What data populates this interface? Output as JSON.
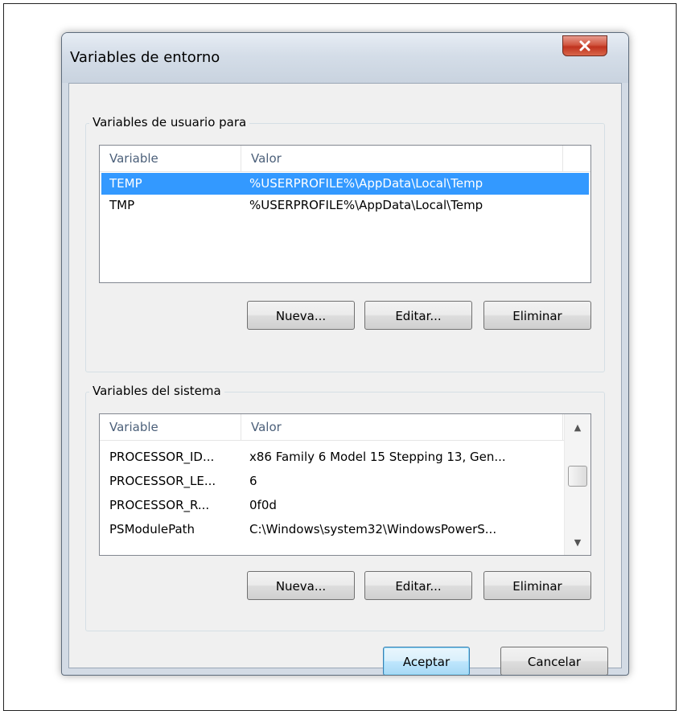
{
  "window": {
    "title": "Variables de entorno",
    "close_label": "X"
  },
  "user_vars": {
    "group_label": "Variables de usuario para",
    "columns": [
      "Variable",
      "Valor"
    ],
    "rows": [
      {
        "name": "TEMP",
        "value": "%USERPROFILE%\\AppData\\Local\\Temp",
        "selected": true
      },
      {
        "name": "TMP",
        "value": "%USERPROFILE%\\AppData\\Local\\Temp",
        "selected": false
      }
    ],
    "buttons": {
      "new": "Nueva...",
      "edit": "Editar...",
      "delete": "Eliminar"
    }
  },
  "system_vars": {
    "group_label": "Variables del sistema",
    "columns": [
      "Variable",
      "Valor"
    ],
    "rows": [
      {
        "name": "PROCESSOR_ID...",
        "value": "x86 Family 6 Model 15 Stepping 13, Gen..."
      },
      {
        "name": "PROCESSOR_LE...",
        "value": "6"
      },
      {
        "name": "PROCESSOR_R...",
        "value": "0f0d"
      },
      {
        "name": "PSModulePath",
        "value": "C:\\Windows\\system32\\WindowsPowerS..."
      }
    ],
    "buttons": {
      "new": "Nueva...",
      "edit": "Editar...",
      "delete": "Eliminar"
    }
  },
  "dialog_buttons": {
    "ok": "Aceptar",
    "cancel": "Cancelar"
  },
  "colors": {
    "selection": "#3399ff",
    "header_text": "#4c607a",
    "close_button": "#c0331e"
  }
}
